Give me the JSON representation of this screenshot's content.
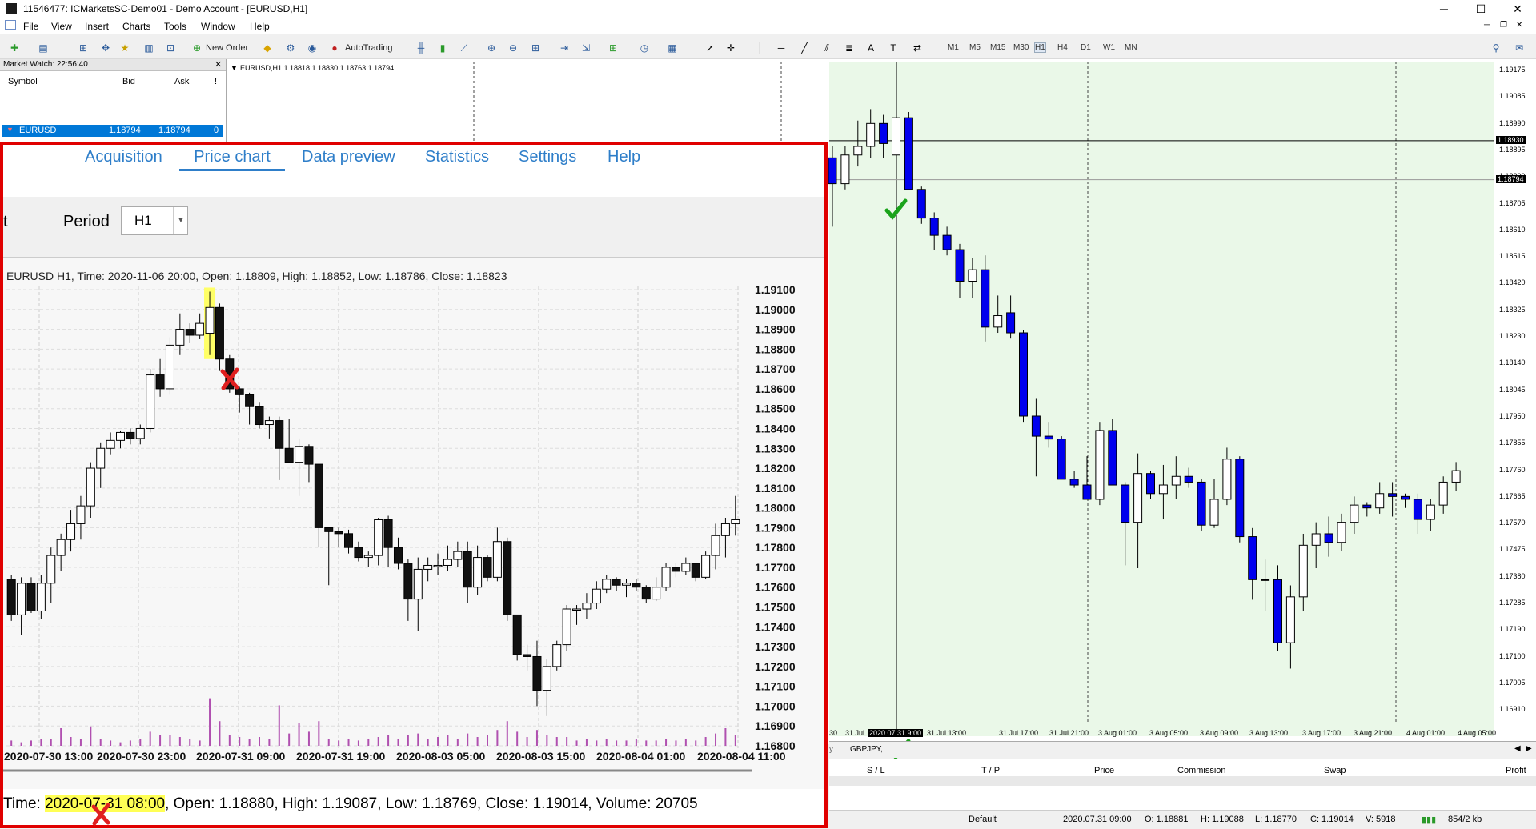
{
  "titlebar": {
    "title": "11546477: ICMarketsSC-Demo01 - Demo Account - [EURUSD,H1]",
    "minimize": "─",
    "maximize": "☐",
    "close": "✕"
  },
  "menu": [
    "File",
    "View",
    "Insert",
    "Charts",
    "Tools",
    "Window",
    "Help"
  ],
  "toolbar": {
    "new_order": "New Order",
    "auto_trading": "AutoTrading",
    "timeframes": [
      "M1",
      "M5",
      "M15",
      "M30",
      "H1",
      "H4",
      "D1",
      "W1",
      "MN"
    ],
    "active_timeframe": "H1"
  },
  "market_watch": {
    "title": "Market Watch: 22:56:40",
    "columns": [
      "Symbol",
      "Bid",
      "Ask",
      "!"
    ],
    "row": {
      "symbol": "EURUSD",
      "bid": "1.18794",
      "ask": "1.18794",
      "flag": "0"
    }
  },
  "mt_chart": {
    "header": "EURUSD,H1  1.18818 1.18830 1.18763 1.18794",
    "price_marker_1": "1.18930",
    "price_marker_2": "1.18794",
    "yaxis": [
      "1.19175",
      "1.19085",
      "1.18990",
      "1.18895",
      "1.18800",
      "1.18705",
      "1.18610",
      "1.18515",
      "1.18420",
      "1.18325",
      "1.18230",
      "1.18140",
      "1.18045",
      "1.17950",
      "1.17855",
      "1.17760",
      "1.17665",
      "1.17570",
      "1.17475",
      "1.17380",
      "1.17285",
      "1.17190",
      "1.17100",
      "1.17005",
      "1.16910"
    ],
    "xaxis": [
      "30",
      "31 Jul",
      "2020.07.31 9:00",
      "31 Jul 13:00",
      "31 Jul 17:00",
      "31 Jul 21:00",
      "3 Aug 01:00",
      "3 Aug 05:00",
      "3 Aug 09:00",
      "3 Aug 13:00",
      "3 Aug 17:00",
      "3 Aug 21:00",
      "4 Aug 01:00",
      "4 Aug 05:00"
    ],
    "sheet_tab": "GBPJPY,",
    "sheet_tab_prefix": "y",
    "colors": {
      "bull": "#ffffff",
      "bear": "#0000ee",
      "wick": "#000000",
      "bg": "#eaf8e8"
    },
    "candles": [
      {
        "o": 1.1887,
        "h": 1.1891,
        "l": 1.1863,
        "c": 1.1878,
        "dir": "down"
      },
      {
        "o": 1.1878,
        "h": 1.1891,
        "l": 1.1876,
        "c": 1.1888,
        "dir": "up"
      },
      {
        "o": 1.1888,
        "h": 1.19,
        "l": 1.1884,
        "c": 1.1891,
        "dir": "up"
      },
      {
        "o": 1.1891,
        "h": 1.1904,
        "l": 1.1887,
        "c": 1.1899,
        "dir": "up"
      },
      {
        "o": 1.1899,
        "h": 1.1902,
        "l": 1.1887,
        "c": 1.1892,
        "dir": "down"
      },
      {
        "o": 1.1888,
        "h": 1.1909,
        "l": 1.1877,
        "c": 1.1901,
        "dir": "up"
      },
      {
        "o": 1.1901,
        "h": 1.1903,
        "l": 1.1878,
        "c": 1.1876,
        "dir": "down"
      },
      {
        "o": 1.1876,
        "h": 1.1877,
        "l": 1.1864,
        "c": 1.1866,
        "dir": "down"
      },
      {
        "o": 1.1866,
        "h": 1.1868,
        "l": 1.1855,
        "c": 1.186,
        "dir": "down"
      },
      {
        "o": 1.186,
        "h": 1.1863,
        "l": 1.1853,
        "c": 1.1855,
        "dir": "down"
      },
      {
        "o": 1.1855,
        "h": 1.1857,
        "l": 1.1838,
        "c": 1.1844,
        "dir": "down"
      },
      {
        "o": 1.1844,
        "h": 1.1852,
        "l": 1.1838,
        "c": 1.1848,
        "dir": "up"
      },
      {
        "o": 1.1848,
        "h": 1.1853,
        "l": 1.1823,
        "c": 1.1828,
        "dir": "down"
      },
      {
        "o": 1.1828,
        "h": 1.1839,
        "l": 1.1826,
        "c": 1.1832,
        "dir": "up"
      },
      {
        "o": 1.1833,
        "h": 1.1839,
        "l": 1.1824,
        "c": 1.1826,
        "dir": "down"
      },
      {
        "o": 1.1826,
        "h": 1.1827,
        "l": 1.1795,
        "c": 1.1797,
        "dir": "down"
      },
      {
        "o": 1.1797,
        "h": 1.1803,
        "l": 1.1776,
        "c": 1.179,
        "dir": "down"
      },
      {
        "o": 1.179,
        "h": 1.1795,
        "l": 1.1786,
        "c": 1.1789,
        "dir": "down"
      },
      {
        "o": 1.1789,
        "h": 1.179,
        "l": 1.178,
        "c": 1.1775,
        "dir": "down"
      },
      {
        "o": 1.1775,
        "h": 1.1778,
        "l": 1.1772,
        "c": 1.1773,
        "dir": "down"
      },
      {
        "o": 1.1773,
        "h": 1.1783,
        "l": 1.1773,
        "c": 1.1768,
        "dir": "down"
      },
      {
        "o": 1.1768,
        "h": 1.1795,
        "l": 1.1766,
        "c": 1.1792,
        "dir": "up"
      },
      {
        "o": 1.1792,
        "h": 1.1796,
        "l": 1.1775,
        "c": 1.1773,
        "dir": "down"
      },
      {
        "o": 1.1773,
        "h": 1.1774,
        "l": 1.1745,
        "c": 1.176,
        "dir": "down"
      },
      {
        "o": 1.176,
        "h": 1.1784,
        "l": 1.1744,
        "c": 1.1777,
        "dir": "up"
      },
      {
        "o": 1.1777,
        "h": 1.1778,
        "l": 1.1768,
        "c": 1.177,
        "dir": "down"
      },
      {
        "o": 1.177,
        "h": 1.178,
        "l": 1.1761,
        "c": 1.1773,
        "dir": "up"
      },
      {
        "o": 1.1773,
        "h": 1.1783,
        "l": 1.1768,
        "c": 1.1776,
        "dir": "up"
      },
      {
        "o": 1.1776,
        "h": 1.1779,
        "l": 1.1772,
        "c": 1.1774,
        "dir": "down"
      },
      {
        "o": 1.1774,
        "h": 1.1775,
        "l": 1.1757,
        "c": 1.1759,
        "dir": "down"
      },
      {
        "o": 1.1759,
        "h": 1.1775,
        "l": 1.1758,
        "c": 1.1768,
        "dir": "up"
      },
      {
        "o": 1.1768,
        "h": 1.1786,
        "l": 1.1766,
        "c": 1.1782,
        "dir": "up"
      },
      {
        "o": 1.1782,
        "h": 1.1783,
        "l": 1.1753,
        "c": 1.1755,
        "dir": "down"
      },
      {
        "o": 1.1755,
        "h": 1.1758,
        "l": 1.1733,
        "c": 1.174,
        "dir": "down"
      },
      {
        "o": 1.174,
        "h": 1.1747,
        "l": 1.1729,
        "c": 1.174,
        "dir": "up"
      },
      {
        "o": 1.174,
        "h": 1.1745,
        "l": 1.1715,
        "c": 1.1718,
        "dir": "down"
      },
      {
        "o": 1.1718,
        "h": 1.1738,
        "l": 1.1709,
        "c": 1.1734,
        "dir": "up"
      },
      {
        "o": 1.1734,
        "h": 1.1756,
        "l": 1.1729,
        "c": 1.1752,
        "dir": "up"
      },
      {
        "o": 1.1752,
        "h": 1.176,
        "l": 1.1744,
        "c": 1.1756,
        "dir": "up"
      },
      {
        "o": 1.1756,
        "h": 1.1762,
        "l": 1.1748,
        "c": 1.1753,
        "dir": "down"
      },
      {
        "o": 1.1753,
        "h": 1.1763,
        "l": 1.175,
        "c": 1.176,
        "dir": "up"
      },
      {
        "o": 1.176,
        "h": 1.1769,
        "l": 1.1756,
        "c": 1.1766,
        "dir": "up"
      },
      {
        "o": 1.1766,
        "h": 1.1767,
        "l": 1.1762,
        "c": 1.1765,
        "dir": "down"
      },
      {
        "o": 1.1765,
        "h": 1.1774,
        "l": 1.1763,
        "c": 1.177,
        "dir": "up"
      },
      {
        "o": 1.177,
        "h": 1.1774,
        "l": 1.1762,
        "c": 1.1769,
        "dir": "down"
      },
      {
        "o": 1.1769,
        "h": 1.177,
        "l": 1.1765,
        "c": 1.1768,
        "dir": "down"
      },
      {
        "o": 1.1768,
        "h": 1.177,
        "l": 1.1756,
        "c": 1.1761,
        "dir": "down"
      },
      {
        "o": 1.1761,
        "h": 1.1768,
        "l": 1.1757,
        "c": 1.1766,
        "dir": "up"
      },
      {
        "o": 1.1766,
        "h": 1.1776,
        "l": 1.1763,
        "c": 1.1774,
        "dir": "up"
      },
      {
        "o": 1.1774,
        "h": 1.1781,
        "l": 1.1771,
        "c": 1.1778,
        "dir": "up"
      }
    ]
  },
  "positions_header": [
    "S / L",
    "T / P",
    "Price",
    "Commission",
    "Swap",
    "Profit"
  ],
  "statusbar": {
    "profile": "Default",
    "time": "2020.07.31 09:00",
    "open": "O: 1.18881",
    "high": "H: 1.19088",
    "low": "L: 1.18770",
    "close": "C: 1.19014",
    "volume": "V: 5918",
    "traffic": "854/2 kb"
  },
  "overlay": {
    "tabs": [
      "Acquisition",
      "Price chart",
      "Data preview",
      "Statistics",
      "Settings",
      "Help"
    ],
    "active_tab": "Price chart",
    "cut_label": "t",
    "period_label": "Period",
    "period_value": "H1",
    "chart_header": "EURUSD H1, Time: 2020-11-06 20:00, Open: 1.18809, High: 1.18852, Low: 1.18786, Close: 1.18823",
    "footer_prefix": "Time: ",
    "footer_time": "2020-07-31 08:00",
    "footer_rest": ", Open: 1.18880, High: 1.19087, Low: 1.18769, Close: 1.19014, Volume: 20705",
    "colors": {
      "highlight": "#ffff66",
      "volume": "#b050b0",
      "frame": "#e00000"
    }
  },
  "chart_data": {
    "type": "candlestick",
    "title": "EURUSD H1, Time: 2020-11-06 20:00, Open: 1.18809, High: 1.18852, Low: 1.18786, Close: 1.18823",
    "ylim": [
      1.168,
      1.191
    ],
    "yticks": [
      "1.19100",
      "1.19000",
      "1.18900",
      "1.18800",
      "1.18700",
      "1.18600",
      "1.18500",
      "1.18400",
      "1.18300",
      "1.18200",
      "1.18100",
      "1.18000",
      "1.17900",
      "1.17800",
      "1.17700",
      "1.17600",
      "1.17500",
      "1.17400",
      "1.17300",
      "1.17200",
      "1.17100",
      "1.17000",
      "1.16900",
      "1.16800"
    ],
    "xticks": [
      "2020-07-30 13:00",
      "2020-07-30 23:00",
      "2020-07-31 09:00",
      "2020-07-31 19:00",
      "2020-08-03 05:00",
      "2020-08-03 15:00",
      "2020-08-04 01:00",
      "2020-08-04 11:00"
    ],
    "highlighted_index": 20,
    "candles": [
      {
        "o": 1.1764,
        "h": 1.1766,
        "l": 1.1743,
        "c": 1.1746,
        "v": 3
      },
      {
        "o": 1.1746,
        "h": 1.1765,
        "l": 1.1736,
        "c": 1.1762,
        "v": 2
      },
      {
        "o": 1.1762,
        "h": 1.1765,
        "l": 1.1747,
        "c": 1.1748,
        "v": 3
      },
      {
        "o": 1.1748,
        "h": 1.1766,
        "l": 1.1744,
        "c": 1.1762,
        "v": 4
      },
      {
        "o": 1.1762,
        "h": 1.178,
        "l": 1.1752,
        "c": 1.1776,
        "v": 4
      },
      {
        "o": 1.1776,
        "h": 1.1787,
        "l": 1.1768,
        "c": 1.1784,
        "v": 10
      },
      {
        "o": 1.1784,
        "h": 1.1799,
        "l": 1.1778,
        "c": 1.1792,
        "v": 5
      },
      {
        "o": 1.1792,
        "h": 1.1806,
        "l": 1.1784,
        "c": 1.1801,
        "v": 4
      },
      {
        "o": 1.1801,
        "h": 1.1823,
        "l": 1.1795,
        "c": 1.182,
        "v": 11
      },
      {
        "o": 1.182,
        "h": 1.1833,
        "l": 1.181,
        "c": 1.183,
        "v": 4
      },
      {
        "o": 1.183,
        "h": 1.1838,
        "l": 1.1827,
        "c": 1.1834,
        "v": 3
      },
      {
        "o": 1.1834,
        "h": 1.1839,
        "l": 1.183,
        "c": 1.1838,
        "v": 2
      },
      {
        "o": 1.1838,
        "h": 1.184,
        "l": 1.1832,
        "c": 1.1835,
        "v": 3
      },
      {
        "o": 1.1835,
        "h": 1.1842,
        "l": 1.1832,
        "c": 1.184,
        "v": 4
      },
      {
        "o": 1.184,
        "h": 1.187,
        "l": 1.1838,
        "c": 1.1867,
        "v": 8
      },
      {
        "o": 1.1867,
        "h": 1.1875,
        "l": 1.1856,
        "c": 1.186,
        "v": 6
      },
      {
        "o": 1.186,
        "h": 1.1886,
        "l": 1.1857,
        "c": 1.1882,
        "v": 6
      },
      {
        "o": 1.1882,
        "h": 1.1898,
        "l": 1.1877,
        "c": 1.189,
        "v": 5
      },
      {
        "o": 1.189,
        "h": 1.1893,
        "l": 1.1883,
        "c": 1.1887,
        "v": 4
      },
      {
        "o": 1.1887,
        "h": 1.1898,
        "l": 1.1885,
        "c": 1.1893,
        "v": 3
      },
      {
        "o": 1.1888,
        "h": 1.1909,
        "l": 1.1877,
        "c": 1.1901,
        "v": 27
      },
      {
        "o": 1.1901,
        "h": 1.1903,
        "l": 1.1869,
        "c": 1.1875,
        "v": 14
      },
      {
        "o": 1.1875,
        "h": 1.1877,
        "l": 1.1858,
        "c": 1.186,
        "v": 6
      },
      {
        "o": 1.186,
        "h": 1.1861,
        "l": 1.1848,
        "c": 1.1857,
        "v": 5
      },
      {
        "o": 1.1857,
        "h": 1.1858,
        "l": 1.1842,
        "c": 1.1851,
        "v": 4
      },
      {
        "o": 1.1851,
        "h": 1.1853,
        "l": 1.184,
        "c": 1.1842,
        "v": 5
      },
      {
        "o": 1.1842,
        "h": 1.1846,
        "l": 1.1835,
        "c": 1.1844,
        "v": 4
      },
      {
        "o": 1.1844,
        "h": 1.1846,
        "l": 1.1814,
        "c": 1.183,
        "v": 23
      },
      {
        "o": 1.183,
        "h": 1.1845,
        "l": 1.1823,
        "c": 1.1823,
        "v": 7
      },
      {
        "o": 1.1823,
        "h": 1.1835,
        "l": 1.1806,
        "c": 1.1831,
        "v": 13
      },
      {
        "o": 1.1831,
        "h": 1.1832,
        "l": 1.1813,
        "c": 1.1822,
        "v": 8
      },
      {
        "o": 1.1822,
        "h": 1.1818,
        "l": 1.178,
        "c": 1.179,
        "v": 14
      },
      {
        "o": 1.179,
        "h": 1.179,
        "l": 1.1761,
        "c": 1.1788,
        "v": 4
      },
      {
        "o": 1.1788,
        "h": 1.179,
        "l": 1.178,
        "c": 1.1787,
        "v": 3
      },
      {
        "o": 1.1787,
        "h": 1.1789,
        "l": 1.1777,
        "c": 1.178,
        "v": 4
      },
      {
        "o": 1.178,
        "h": 1.1783,
        "l": 1.1773,
        "c": 1.1775,
        "v": 3
      },
      {
        "o": 1.1775,
        "h": 1.1778,
        "l": 1.177,
        "c": 1.1776,
        "v": 4
      },
      {
        "o": 1.1776,
        "h": 1.1795,
        "l": 1.1771,
        "c": 1.1794,
        "v": 5
      },
      {
        "o": 1.1794,
        "h": 1.1796,
        "l": 1.177,
        "c": 1.178,
        "v": 6
      },
      {
        "o": 1.178,
        "h": 1.1785,
        "l": 1.1769,
        "c": 1.1772,
        "v": 4
      },
      {
        "o": 1.1772,
        "h": 1.1774,
        "l": 1.1743,
        "c": 1.1754,
        "v": 6
      },
      {
        "o": 1.1754,
        "h": 1.1775,
        "l": 1.1738,
        "c": 1.1769,
        "v": 7
      },
      {
        "o": 1.1769,
        "h": 1.1775,
        "l": 1.1763,
        "c": 1.1771,
        "v": 4
      },
      {
        "o": 1.1771,
        "h": 1.1777,
        "l": 1.1766,
        "c": 1.1771,
        "v": 5
      },
      {
        "o": 1.1771,
        "h": 1.1781,
        "l": 1.1768,
        "c": 1.1774,
        "v": 6
      },
      {
        "o": 1.1774,
        "h": 1.1783,
        "l": 1.177,
        "c": 1.1778,
        "v": 4
      },
      {
        "o": 1.1778,
        "h": 1.1783,
        "l": 1.1752,
        "c": 1.176,
        "v": 7
      },
      {
        "o": 1.176,
        "h": 1.1781,
        "l": 1.1756,
        "c": 1.1775,
        "v": 5
      },
      {
        "o": 1.1775,
        "h": 1.1776,
        "l": 1.1763,
        "c": 1.1765,
        "v": 6
      },
      {
        "o": 1.1765,
        "h": 1.179,
        "l": 1.1763,
        "c": 1.1783,
        "v": 9
      },
      {
        "o": 1.1783,
        "h": 1.1785,
        "l": 1.1743,
        "c": 1.1746,
        "v": 14
      },
      {
        "o": 1.1746,
        "h": 1.1746,
        "l": 1.1723,
        "c": 1.1726,
        "v": 8
      },
      {
        "o": 1.1726,
        "h": 1.1731,
        "l": 1.1718,
        "c": 1.1725,
        "v": 5
      },
      {
        "o": 1.1725,
        "h": 1.1733,
        "l": 1.17,
        "c": 1.1708,
        "v": 9
      },
      {
        "o": 1.1708,
        "h": 1.1724,
        "l": 1.1695,
        "c": 1.172,
        "v": 6
      },
      {
        "o": 1.172,
        "h": 1.1733,
        "l": 1.1718,
        "c": 1.1731,
        "v": 5
      },
      {
        "o": 1.1731,
        "h": 1.1751,
        "l": 1.1728,
        "c": 1.1749,
        "v": 5
      },
      {
        "o": 1.1749,
        "h": 1.1751,
        "l": 1.1741,
        "c": 1.1749,
        "v": 3
      },
      {
        "o": 1.1749,
        "h": 1.1757,
        "l": 1.1744,
        "c": 1.1752,
        "v": 4
      },
      {
        "o": 1.1752,
        "h": 1.1763,
        "l": 1.1749,
        "c": 1.1759,
        "v": 3
      },
      {
        "o": 1.1759,
        "h": 1.1766,
        "l": 1.1757,
        "c": 1.1764,
        "v": 4
      },
      {
        "o": 1.1764,
        "h": 1.1765,
        "l": 1.1758,
        "c": 1.1761,
        "v": 3
      },
      {
        "o": 1.1761,
        "h": 1.1764,
        "l": 1.1755,
        "c": 1.1762,
        "v": 3
      },
      {
        "o": 1.1762,
        "h": 1.1764,
        "l": 1.1758,
        "c": 1.176,
        "v": 4
      },
      {
        "o": 1.176,
        "h": 1.1761,
        "l": 1.1752,
        "c": 1.1754,
        "v": 3
      },
      {
        "o": 1.1754,
        "h": 1.1765,
        "l": 1.1753,
        "c": 1.176,
        "v": 3
      },
      {
        "o": 1.176,
        "h": 1.1772,
        "l": 1.1758,
        "c": 1.177,
        "v": 4
      },
      {
        "o": 1.177,
        "h": 1.1772,
        "l": 1.1765,
        "c": 1.1768,
        "v": 3
      },
      {
        "o": 1.1768,
        "h": 1.1775,
        "l": 1.1766,
        "c": 1.1772,
        "v": 4
      },
      {
        "o": 1.1772,
        "h": 1.1772,
        "l": 1.1763,
        "c": 1.1765,
        "v": 3
      },
      {
        "o": 1.1765,
        "h": 1.1778,
        "l": 1.1764,
        "c": 1.1776,
        "v": 5
      },
      {
        "o": 1.1776,
        "h": 1.1792,
        "l": 1.1769,
        "c": 1.1786,
        "v": 7
      },
      {
        "o": 1.1786,
        "h": 1.1795,
        "l": 1.1775,
        "c": 1.1792,
        "v": 10
      },
      {
        "o": 1.1792,
        "h": 1.1806,
        "l": 1.1786,
        "c": 1.1794,
        "v": 6
      }
    ]
  }
}
